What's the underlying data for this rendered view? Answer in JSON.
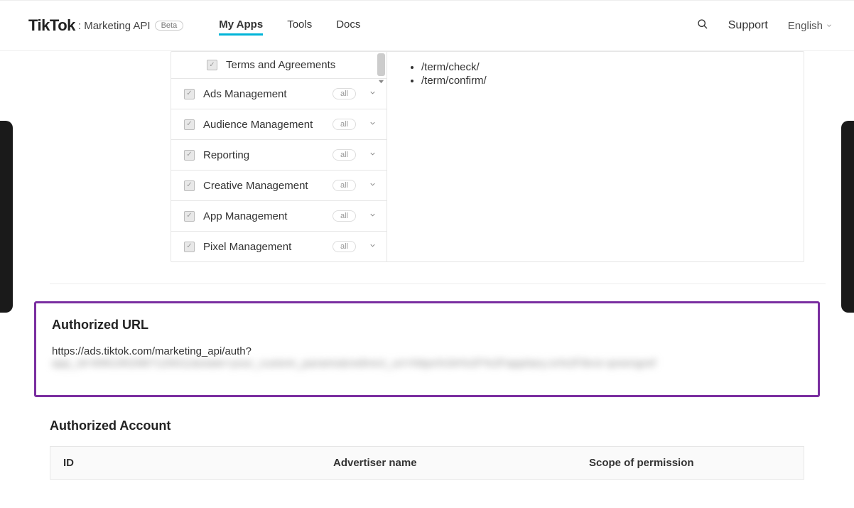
{
  "header": {
    "logo_main": "TikTok",
    "logo_sub": ": Marketing API",
    "beta_badge": "Beta",
    "nav": [
      {
        "label": "My Apps",
        "active": true
      },
      {
        "label": "Tools",
        "active": false
      },
      {
        "label": "Docs",
        "active": false
      }
    ],
    "support_label": "Support",
    "language_label": "English"
  },
  "permissions": {
    "sub_item": {
      "label": "Terms and Agreements"
    },
    "rows": [
      {
        "label": "Ads Management",
        "tag": "all"
      },
      {
        "label": "Audience Management",
        "tag": "all"
      },
      {
        "label": "Reporting",
        "tag": "all"
      },
      {
        "label": "Creative Management",
        "tag": "all"
      },
      {
        "label": "App Management",
        "tag": "all"
      },
      {
        "label": "Pixel Management",
        "tag": "all"
      }
    ],
    "endpoints": [
      "/term/check/",
      "/term/confirm/"
    ]
  },
  "authorized_url": {
    "title": "Authorized URL",
    "visible_prefix": "https://ads.tiktok.com/marketing_api/auth?",
    "blurred_tail": "app_id=6961952687120011&state=your_custom_params&redirect_uri=https%3A%2F%2Fappitary.io%2Fibroi-qreengref"
  },
  "authorized_account": {
    "title": "Authorized Account",
    "columns": {
      "id": "ID",
      "advertiser": "Advertiser name",
      "scope": "Scope of permission"
    }
  }
}
